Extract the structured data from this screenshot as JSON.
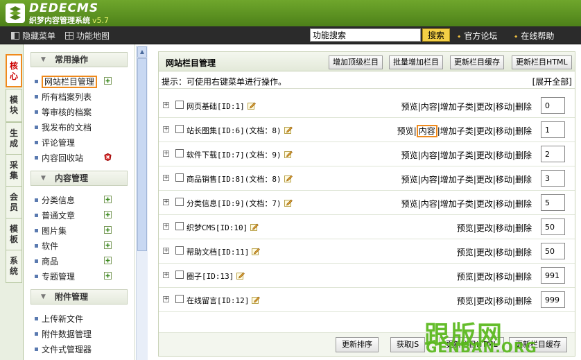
{
  "header": {
    "logo_title": "DEDECMS",
    "logo_subtitle": "织梦内容管理系统",
    "version": "v5.7"
  },
  "toolbar": {
    "hide_menu": "隐藏菜单",
    "function_map": "功能地图",
    "search_value": "功能搜索",
    "search_button": "搜索",
    "forum_link": "官方论坛",
    "help_link": "在线帮助"
  },
  "vtabs": [
    {
      "label": "核心",
      "active": true
    },
    {
      "label": "模块",
      "active": false
    },
    {
      "label": "生成",
      "active": false
    },
    {
      "label": "采集",
      "active": false
    },
    {
      "label": "会员",
      "active": false
    },
    {
      "label": "模板",
      "active": false
    },
    {
      "label": "系统",
      "active": false
    }
  ],
  "menu": {
    "section1": {
      "title": "常用操作",
      "items": [
        "网站栏目管理",
        "所有档案列表",
        "等审核的档案",
        "我发布的文档",
        "评论管理",
        "内容回收站"
      ]
    },
    "section2": {
      "title": "内容管理",
      "items": [
        "分类信息",
        "普通文章",
        "图片集",
        "软件",
        "商品",
        "专题管理"
      ]
    },
    "section3": {
      "title": "附件管理",
      "items": [
        "上传新文件",
        "附件数据管理",
        "文件式管理器"
      ]
    }
  },
  "main": {
    "title": "网站栏目管理",
    "buttons": {
      "add_top": "增加顶级栏目",
      "batch_add": "批量增加栏目",
      "update_cache": "更新栏目缓存",
      "update_html": "更新栏目HTML"
    },
    "tip": "提示：可使用右键菜单进行操作。",
    "expand_all": "[展开全部]",
    "ops_labels": {
      "preview": "预览",
      "content": "内容",
      "add_sub": "增加子类",
      "edit": "更改",
      "move": "移动",
      "delete": "删除"
    },
    "rows": [
      {
        "name": "网页基础[ID:1]",
        "order": "0"
      },
      {
        "name": "站长图集[ID:6](文档：8)",
        "order": "1"
      },
      {
        "name": "软件下载[ID:7](文档：9)",
        "order": "2"
      },
      {
        "name": "商品销售[ID:8](文档：8)",
        "order": "3"
      },
      {
        "name": "分类信息[ID:9](文档：7)",
        "order": "5"
      },
      {
        "name": "织梦CMS[ID:10]",
        "order": "50"
      },
      {
        "name": "帮助文档[ID:11]",
        "order": "50"
      },
      {
        "name": "圈子[ID:13]",
        "order": "991"
      },
      {
        "name": "在线留言[ID:12]",
        "order": "999"
      }
    ],
    "footer": {
      "sort_button": "更新排序",
      "getjs_button": "获取JS",
      "update_html_button": "更新栏目HTML",
      "update_cache_button": "更新栏目缓存"
    }
  },
  "watermark": {
    "cn": "跟版网",
    "en": "GENBAN.ORG"
  }
}
